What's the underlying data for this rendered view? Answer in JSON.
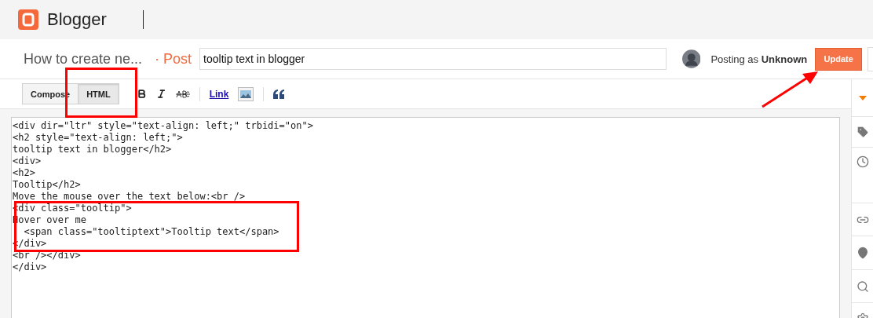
{
  "app": {
    "name": "Blogger"
  },
  "post_header": {
    "blog_title": "How to create ne...",
    "section": "· Post",
    "title_field": {
      "value": "tooltip text in blogger"
    },
    "posting_as": {
      "prefix": "Posting as",
      "user": "Unknown"
    },
    "update_button": "Update"
  },
  "mode_tabs": [
    {
      "label": "Compose",
      "selected": false
    },
    {
      "label": "HTML",
      "selected": true
    }
  ],
  "toolbar": [
    {
      "kind": "bold"
    },
    {
      "kind": "italic"
    },
    {
      "kind": "strike"
    },
    {
      "kind": "separator"
    },
    {
      "kind": "link",
      "label": "Link"
    },
    {
      "kind": "image"
    },
    {
      "kind": "separator"
    },
    {
      "kind": "quote"
    }
  ],
  "code_lines": [
    "<div dir=\"ltr\" style=\"text-align: left;\" trbidi=\"on\">",
    "<h2 style=\"text-align: left;\">",
    "tooltip text in blogger</h2>",
    "<div>",
    "<h2>",
    "Tooltip</h2>",
    "Move the mouse over the text below:<br />",
    "<div class=\"tooltip\">",
    "Hover over me",
    "  <span class=\"tooltiptext\">Tooltip text</span>",
    "</div>",
    "<br /></div>",
    "</div>"
  ],
  "sidebar": [
    {
      "kind": "caret"
    },
    {
      "kind": "tag"
    },
    {
      "kind": "clock"
    },
    {
      "kind": "link"
    },
    {
      "kind": "pin"
    },
    {
      "kind": "search"
    },
    {
      "kind": "gear"
    }
  ]
}
